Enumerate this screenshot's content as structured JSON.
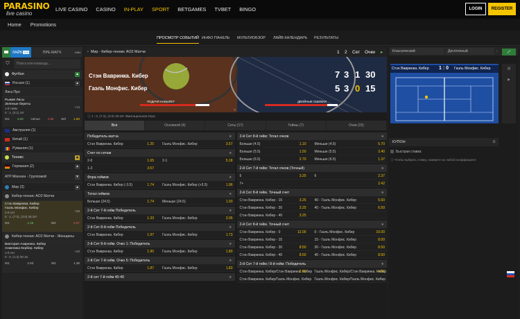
{
  "header": {
    "logo_main": "PARASINO",
    "logo_sub": "live casino",
    "nav": [
      "LIVE CASINO",
      "CASINO",
      "IN-PLAY",
      "SPORT",
      "BETGAMES",
      "TVBET",
      "BINGO"
    ],
    "login": "LOGIN",
    "register": "REGISTER"
  },
  "subnav": [
    "Home",
    "Promotions"
  ],
  "tabs": [
    "ПРОСМОТР СОБЫТИЙ",
    "ИНФО ПАНЕЛЬ",
    "МУЛЬТИОБЗОР",
    "ЛАЙВ КАЛЕНДАРЬ",
    "РЕЗУЛЬТАТЫ"
  ],
  "left": {
    "tabs": [
      "ЛАЙВ",
      "975",
      "ПРЕ-МАТЧ",
      "1984"
    ],
    "search_placeholder": "Поиск или команда...",
    "football": "Футбол",
    "russia": "Россия (1)",
    "league": "Лига Про",
    "match1": {
      "t1": "Рыжие Лисы",
      "t2": "Зеленые береты",
      "p": "1-й тайм",
      "score": "0 : 1, (0:1) 19'",
      "side": "+14",
      "w1": "W1",
      "o1": "4.60",
      "x": "Ничья",
      "o2": "4.95",
      "w2": "W2",
      "o3": "1.50"
    },
    "australia": "Австралия (1)",
    "china": "Китай (1)",
    "romania": "Румыния (1)",
    "tennis": "Теннис",
    "germany": "Германия (2)",
    "atp": "ATP Мюнхен - Групповой",
    "world": "Мир (3)",
    "cyber": "Кибер-теннис AO2 Матчи",
    "match2": {
      "t1": "Стэн Вавринка. Кибер",
      "t2": "Гаэль Монфис. Кибер",
      "p": "2-й сет",
      "score": "0 : 1, (7:3), (3:0) 30:15*",
      "side": "+28",
      "w1": "W1",
      "o1": "1.35",
      "w2": "W2",
      "o2": "5.87"
    },
    "cyber_w": "Кибер-теннис AO2 Матчи - Женщины",
    "match3": {
      "t1": "Виктория Азаренка. Кибер",
      "t2": "Анжелика Кербер. Кибер",
      "p": "1-й сет",
      "score": "0 : 0, (1:3) 30:15",
      "side": "+20",
      "w1": "W1",
      "o1": "2.93",
      "w2": "W2",
      "o2": "1.38"
    }
  },
  "event": {
    "title": "Мир - Кибер-теннис AO2 Матчи",
    "cols": [
      "1",
      "2",
      "Сет",
      "Очки"
    ],
    "p1": "Стэн Вавринка. Кибер",
    "p2": "Гаэль Монфис. Кибер",
    "s1": [
      "7",
      "3",
      "1",
      "30"
    ],
    "s2": [
      "5",
      "3",
      "0",
      "15"
    ],
    "lbl1": "ПОДАЧИ НАВЫЛЕТ",
    "lbl2": "ДВОЙНЫЕ ОШИБКИ",
    "info": "1 : 0, (7:3), (3:0) 30:15* Имитационная Игра"
  },
  "filters": [
    "Все",
    "Основной (4)",
    "Сеты (17)",
    "Геймы (7)",
    "Очки (15)"
  ],
  "left_markets": [
    {
      "h": "Победитель матча",
      "rows": [
        [
          "Стэн Вавринка. Кибер",
          "1.25",
          "Гаэль Монфис. Кибер",
          "3.57"
        ]
      ]
    },
    {
      "h": "Счет по сетам",
      "rows": [
        [
          "2-0",
          "1.65",
          "2-1",
          "5.18"
        ],
        [
          "1-2",
          "3.57",
          "",
          ""
        ]
      ]
    },
    {
      "h": "Фора геймов",
      "rows": [
        [
          "Стэн Вавринка. Кибер (-3.5)",
          "1.74",
          "Гаэль Монфис. Кибер (+3.5)",
          "1.96"
        ]
      ]
    },
    {
      "h": "Тотал геймов",
      "rows": [
        [
          "Больше (24.5)",
          "1.74",
          "Меньше (24.5)",
          "1.93"
        ]
      ]
    },
    {
      "h": "2-й Сет 7-й гейм Победитель",
      "rows": [
        [
          "Стэн Вавринка. Кибер",
          "1.33",
          "Гаэль Монфис. Кибер",
          "3.05"
        ]
      ]
    },
    {
      "h": "2-й Сет 8-й гейм Победитель",
      "rows": [
        [
          "Стэн Вавринка. Кибер",
          "1.97",
          "Гаэль Монфис. Кибер",
          "1.73"
        ]
      ]
    },
    {
      "h": "2-й Сет 8-й гейм. Очко 1: Победитель",
      "rows": [
        [
          "Стэн Вавринка. Кибер",
          "1.90",
          "Гаэль Монфис. Кибер",
          "1.80"
        ]
      ]
    },
    {
      "h": "2-й Сет 7-й гейм. Очко 5: Победитель",
      "rows": [
        [
          "Стэн Вавринка. Кибер",
          "1.87",
          "Гаэль Монфис. Кибер",
          "1.83"
        ]
      ]
    },
    {
      "h": "2-й сет 7-й гейм 40-40",
      "rows": []
    }
  ],
  "right_markets": [
    {
      "h": "2-й Сет 8-й гейм: Тотал очков",
      "rows": [
        [
          "Больше (4.5)",
          "1.10",
          "Меньше (4.5)",
          "5.70"
        ],
        [
          "Больше (5.5)",
          "1.50",
          "Меньше (5.5)",
          "2.40"
        ],
        [
          "Больше (6.5)",
          "2.70",
          "Меньше (6.5)",
          "1.37"
        ]
      ]
    },
    {
      "h": "2-й Сет 7-й гейм: Тотал очков (Точный)",
      "rows": [
        [
          "5",
          "3.25",
          "6",
          "2.37"
        ],
        [
          "7+",
          "",
          "",
          "2.42"
        ]
      ]
    },
    {
      "h": "2-й Сет 8-й гейм. Точный счет",
      "rows": [
        [
          "Стэн Вавринка. Кибер - 15",
          "3.25",
          "40 - Гаэль Монфис. Кибер",
          "5.60"
        ],
        [
          "Стэн Вавринка. Кибер - 30",
          "3.25",
          "40 - Гаэль Монфис. Кибер",
          "6.50"
        ],
        [
          "Стэн Вавринка. Кибер - 40",
          "3.25",
          "",
          ""
        ]
      ]
    },
    {
      "h": "2-й Сет 8-й гейм. Точный счет",
      "rows": [
        [
          "Стэн Вавринка. Кибер - 0",
          "12.00",
          "0 - Гаэль Монфис. Кибер",
          "10.00"
        ],
        [
          "Стэн Вавринка. Кибер - 15",
          "",
          "15 - Гаэль Монфис. Кибер",
          "8.00"
        ],
        [
          "Стэн Вавринка. Кибер - 30",
          "8.50",
          "30 - Гаэль Монфис. Кибер",
          "8.50"
        ],
        [
          "Стэн Вавринка. Кибер - 40",
          "8.50",
          "40 - Гаэль Монфис. Кибер",
          "8.50"
        ]
      ]
    },
    {
      "h": "2-й Сет 7-й гейм / 8-й гейм: Победитель",
      "rows": [
        [
          "Стэн Вавринка. Кибер/Стэн Вавринка. Кибер",
          "2.60",
          "Гаэль Монфис. Кибер/Стэн Вавринка. Кибер",
          "4.00"
        ],
        [
          "Стэн Вавринка. Кибер/Гаэль Монфис. Кибер",
          "",
          "Гаэль Монфис. Кибер/Гаэль Монфис. Кибер",
          ""
        ]
      ]
    }
  ],
  "right": {
    "sel1": "Классический",
    "sel2": "Десятичный",
    "p1": "Стэн Вавринка. Кибер",
    "p2": "Гаэль Монфис. Кибер",
    "score": "1 : 0",
    "coupon": "КУПОН",
    "quick": "Быстрая ставка",
    "hint": "Чтобы выбрать ставку, нажмите на любой коэффициент"
  },
  "colors": {
    "accent": "#f5c400",
    "live": "#1f78c4"
  }
}
